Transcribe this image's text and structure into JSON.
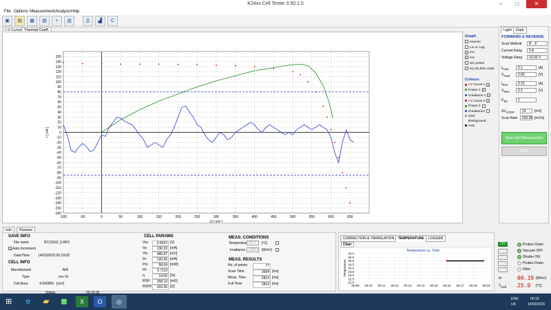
{
  "app": {
    "title": "K24xx Cell Tester 3.50.1.0"
  },
  "window_controls": {
    "minimize": "–",
    "maximize": "□",
    "close": "✕"
  },
  "menu": [
    "File",
    "Options",
    "Measurement",
    "Analysis",
    "Help"
  ],
  "toolbar_icons": [
    "open-icon",
    "save-icon",
    "report-icon",
    "export-icon",
    "add-icon",
    "calc-icon",
    "print-icon",
    "signal-icon",
    "c-icon"
  ],
  "graph_tabs": [
    "I-V Curve",
    "Thermal Coeff."
  ],
  "chart_data": {
    "type": "line",
    "xlabel": "U [ mV ]",
    "ylabel": "I [ mA ]",
    "xlim": [
      -100,
      700
    ],
    "ylim": [
      -160,
      160
    ],
    "x_ticks": [
      -100,
      -50,
      0,
      50,
      100,
      150,
      200,
      250,
      300,
      350,
      400,
      450,
      500,
      550,
      600,
      650
    ],
    "y_ticks": [
      150,
      140,
      130,
      120,
      110,
      100,
      90,
      80,
      70,
      60,
      50,
      40,
      30,
      20,
      10,
      0,
      -10,
      -20,
      -30,
      -40,
      -50,
      -60,
      -70,
      -80,
      -90,
      -100,
      -110,
      -120,
      -130,
      -140,
      -150,
      -160
    ],
    "grid": true,
    "series": [
      {
        "name": "I-V Curve 1",
        "color": "#cc0000",
        "style": "dots",
        "points": [
          [
            -100,
            138
          ],
          [
            -50,
            136
          ],
          [
            0,
            136
          ],
          [
            50,
            135
          ],
          [
            100,
            135
          ],
          [
            150,
            135
          ],
          [
            200,
            134
          ],
          [
            250,
            134
          ],
          [
            300,
            133
          ],
          [
            350,
            132
          ],
          [
            400,
            130
          ],
          [
            450,
            126
          ],
          [
            500,
            120
          ],
          [
            520,
            114
          ],
          [
            540,
            100
          ],
          [
            560,
            80
          ],
          [
            580,
            52
          ],
          [
            590,
            30
          ],
          [
            600,
            5
          ],
          [
            610,
            -20
          ],
          [
            620,
            -50
          ],
          [
            630,
            -80
          ],
          [
            640,
            -110
          ],
          [
            650,
            -140
          ]
        ]
      },
      {
        "name": "Power 1",
        "color": "#1a8a1a",
        "style": "line",
        "points": [
          [
            0,
            0
          ],
          [
            50,
            25
          ],
          [
            100,
            45
          ],
          [
            150,
            62
          ],
          [
            200,
            76
          ],
          [
            250,
            90
          ],
          [
            300,
            102
          ],
          [
            350,
            112
          ],
          [
            400,
            122
          ],
          [
            450,
            128
          ],
          [
            480,
            132
          ],
          [
            500,
            134
          ],
          [
            520,
            135
          ],
          [
            540,
            132
          ],
          [
            560,
            118
          ],
          [
            580,
            92
          ],
          [
            595,
            60
          ],
          [
            605,
            28
          ]
        ]
      },
      {
        "name": "Irradiance 1",
        "color": "#2a3ac8",
        "style": "line",
        "points": [
          [
            -100,
            15
          ],
          [
            -90,
            -5
          ],
          [
            -80,
            -35
          ],
          [
            -70,
            -40
          ],
          [
            -60,
            -30
          ],
          [
            -50,
            -22
          ],
          [
            -40,
            -28
          ],
          [
            -30,
            -38
          ],
          [
            -20,
            -35
          ],
          [
            -10,
            -20
          ],
          [
            0,
            -5
          ],
          [
            10,
            -8
          ],
          [
            20,
            10
          ],
          [
            30,
            20
          ],
          [
            40,
            30
          ],
          [
            50,
            28
          ],
          [
            60,
            22
          ],
          [
            70,
            18
          ],
          [
            80,
            15
          ],
          [
            90,
            5
          ],
          [
            100,
            -5
          ],
          [
            110,
            -15
          ],
          [
            120,
            -30
          ],
          [
            130,
            -25
          ],
          [
            140,
            -20
          ],
          [
            150,
            -25
          ],
          [
            160,
            -30
          ],
          [
            170,
            -15
          ],
          [
            180,
            -5
          ],
          [
            190,
            10
          ],
          [
            200,
            30
          ],
          [
            210,
            50
          ],
          [
            220,
            52
          ],
          [
            230,
            40
          ],
          [
            240,
            30
          ],
          [
            250,
            15
          ],
          [
            260,
            10
          ],
          [
            270,
            -5
          ],
          [
            280,
            -15
          ],
          [
            290,
            -20
          ],
          [
            300,
            -10
          ],
          [
            310,
            0
          ],
          [
            320,
            -5
          ],
          [
            330,
            -15
          ],
          [
            340,
            -10
          ],
          [
            350,
            0
          ],
          [
            360,
            5
          ],
          [
            370,
            10
          ],
          [
            380,
            15
          ],
          [
            390,
            20
          ],
          [
            400,
            15
          ],
          [
            410,
            5
          ],
          [
            420,
            0
          ],
          [
            430,
            10
          ],
          [
            440,
            15
          ],
          [
            450,
            10
          ],
          [
            460,
            5
          ],
          [
            470,
            0
          ],
          [
            480,
            -5
          ],
          [
            490,
            0
          ],
          [
            500,
            -5
          ],
          [
            510,
            5
          ],
          [
            520,
            10
          ],
          [
            530,
            15
          ],
          [
            540,
            10
          ],
          [
            550,
            5
          ],
          [
            560,
            10
          ],
          [
            570,
            15
          ],
          [
            580,
            10
          ],
          [
            590,
            5
          ],
          [
            600,
            -10
          ],
          [
            610,
            -40
          ],
          [
            620,
            -60
          ],
          [
            630,
            -20
          ],
          [
            640,
            5
          ],
          [
            650,
            -15
          ],
          [
            660,
            -20
          ]
        ]
      },
      {
        "name": "Irradiance ref",
        "color": "#2a3ac8",
        "style": "dashed-hline",
        "value": 80
      },
      {
        "name": "Irradiance ref 2",
        "color": "#2a3ac8",
        "style": "dashed-hline",
        "value": -85
      }
    ]
  },
  "graph_options": {
    "title": "Graph",
    "items": [
      {
        "label": "Inverse",
        "checked": false
      },
      {
        "label": "Lin or Log",
        "checked": false
      },
      {
        "label": "mA",
        "checked": true
      },
      {
        "label": "mV",
        "checked": true
      },
      {
        "label": "S/L points",
        "checked": false
      },
      {
        "label": "Isc,Rs,Rsh Units",
        "checked": false
      }
    ]
  },
  "colours": {
    "title": "Colours",
    "items": [
      {
        "label": "I-V Curve 1",
        "color": "#cc0000",
        "checked": true
      },
      {
        "label": "Power 1",
        "color": "#1a8a1a",
        "checked": true
      },
      {
        "label": "Irradiance 1",
        "color": "#2a3ac8",
        "checked": true
      },
      {
        "label": "I-V Curve 2",
        "color": "#cc0000",
        "checked": true
      },
      {
        "label": "Power 2",
        "color": "#1a8a1a",
        "checked": false
      },
      {
        "label": "Irradiance2",
        "color": "#2a3ac8",
        "checked": false
      },
      {
        "label": "Grid",
        "color": "#888888",
        "checked": false
      },
      {
        "label": "Background",
        "color": "#ffffff",
        "checked": false
      },
      {
        "label": "Axis",
        "color": "#000000",
        "checked": false
      }
    ]
  },
  "right_panel": {
    "tabs": [
      "Light",
      "Dark"
    ],
    "section": "FORWARD & REVERSE",
    "scan_method": {
      "label": "Scan Method",
      "value": "R→F"
    },
    "current_rang": {
      "label": "Current Rang",
      "value": "5 A"
    },
    "voltage_rang": {
      "label": "Voltage Rang",
      "value": "10.00 V"
    },
    "i_fwd": {
      "label": "I",
      "sub": "Fwd",
      "value": "0.1",
      "unit": "[A]"
    },
    "v_fwd": {
      "label": "V",
      "sub": "Fwd",
      "value": "0.65",
      "unit": "[V]"
    },
    "i_rev": {
      "label": "I",
      "sub": "Rev",
      "value": "0.15",
      "unit": "[A]"
    },
    "v_rev": {
      "label": "V",
      "sub": "Rev",
      "value": "0.1",
      "unit": "[V]"
    },
    "k_sh": {
      "label": "K",
      "sub": "Sh",
      "value": "1"
    },
    "dv_step": {
      "label": "ΔV",
      "sub": "STEP",
      "value": "10",
      "unit": "[mV]"
    },
    "scan_rate": {
      "label": "Scan Rate",
      "value": "500.00",
      "unit": "[mV/s]"
    },
    "start_button": "Start Light Measurement",
    "stop_button": "STOP"
  },
  "bottom_tabs": [
    "Info",
    "Params"
  ],
  "save_info": {
    "title": "SAVE INFO",
    "file_name_label": "File name",
    "file_name": "RC11502_5.RF0",
    "auto_increment": "Auto Increment",
    "datetime_label": "Date/Time",
    "datetime": "14/03/2015 00:19:00"
  },
  "cell_info": {
    "title": "CELL INFO",
    "manufacturer_label": "Manufacturer",
    "manufacturer": "N/A",
    "type_label": "Type",
    "type": "exc-Si",
    "cell_area_label": "Cell Area",
    "cell_area": "4.000000",
    "cell_area_unit": "[cm²]"
  },
  "cell_params": {
    "title": "CELL PARAMS",
    "rows": [
      {
        "label": "Voc",
        "value": "0.6032",
        "unit": "[V]"
      },
      {
        "label": "Isc",
        "value": "136.33",
        "unit": "[mA]"
      },
      {
        "label": "Vm",
        "value": "486.87",
        "unit": "[mV]"
      },
      {
        "label": "Im",
        "value": "120.45",
        "unit": "[mA]"
      },
      {
        "label": "Pm",
        "value": "58.64",
        "unit": "[mW]"
      },
      {
        "label": "FF",
        "value": "0.7113",
        "unit": ""
      },
      {
        "label": "η",
        "value": "14.66",
        "unit": "[%]"
      },
      {
        "label": "RSH",
        "value": "258.19",
        "unit": "[mΩ]"
      },
      {
        "label": "RSH2",
        "value": "203.36",
        "unit": "[Ω]"
      }
    ]
  },
  "meas_conditions": {
    "title": "MEAS. CONDITIONS",
    "temperature_label": "Temperature",
    "temperature": "25.0",
    "temperature_unit": "[ºC]",
    "irradiance_label": "Irradiance",
    "irradiance": "1000.0",
    "irradiance_unit": "[W/m²]"
  },
  "meas_results": {
    "title": "MEAS. RESULTS",
    "rows": [
      {
        "label": "No. of points",
        "value": "77",
        "unit": ""
      },
      {
        "label": "Scan Time",
        "value": "2684",
        "unit": "[ms]"
      },
      {
        "label": "Meas. Time",
        "value": "2814",
        "unit": "[ms]"
      },
      {
        "label": "Full Time",
        "value": "2814",
        "unit": "[ms]"
      }
    ]
  },
  "temp_tabs": [
    "CORRECTION & TRANSLATION",
    "TEMPERATURE",
    "LOGGER"
  ],
  "temp_chart": {
    "clear": "Clear",
    "title": "Temperature vs. Time",
    "ylabel": "Temperature",
    "y_ticks": [
      "26.0",
      "25.5",
      "25.0",
      "24.5",
      "24.0",
      "23.5",
      "23.0",
      "22.5",
      "22.0"
    ],
    "x_ticks": [
      "00:09",
      "00:10",
      "00:11",
      "00:12",
      "00:13",
      "00:14",
      "00:15",
      "00:16",
      "00:17",
      "00:18",
      "00:19"
    ]
  },
  "status_panel": {
    "on_label": "ON",
    "probes_down_1": "Probes Down",
    "vacuum": "Vacuum OFF",
    "shutter": "Shutter ON",
    "probes_down_2": "Probes Down",
    "filter": "Filter",
    "irr_label": "Irr",
    "irr_value": "00.19",
    "irr_unit": "[W/m²]",
    "t_label": "T",
    "t_sub": "Cell",
    "t_value": "25.0",
    "t_unit": "[°C]"
  },
  "status_bar": {
    "status_label": "Status",
    "time": "00:19:35"
  },
  "taskbar": {
    "apps": [
      "start-icon",
      "ie-icon",
      "explorer-icon",
      "store-icon",
      "excel-icon",
      "outlook-icon",
      "cell-tester-icon"
    ],
    "lang": "ENG",
    "region": "UK",
    "clock_time": "00:19",
    "clock_date": "14/03/2015"
  }
}
